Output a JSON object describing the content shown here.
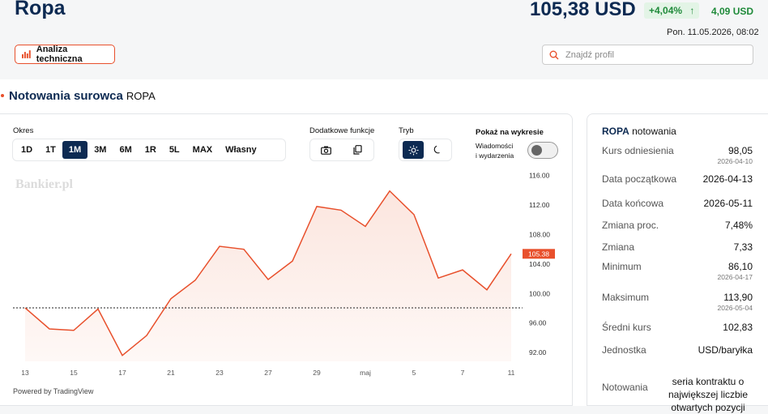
{
  "header": {
    "title": "Ropa",
    "price": "105,38 USD",
    "change_pct": "+4,04%",
    "change_arrow": "↑",
    "change_abs": "4,09 USD",
    "datetime": "Pon. 11.05.2026, 08:02",
    "tech_button": "Analiza techniczna",
    "search_placeholder": "Znajdź profil"
  },
  "section": {
    "title": "Notowania surowca",
    "subtitle": "ROPA"
  },
  "controls": {
    "period_label": "Okres",
    "periods": [
      "1D",
      "1T",
      "1M",
      "3M",
      "6M",
      "1R",
      "5L",
      "MAX",
      "Własny"
    ],
    "active_period": "1M",
    "additional_label": "Dodatkowe funkcje",
    "mode_label": "Tryb",
    "show_label": "Pokaż na wykresie",
    "news_label_1": "Wiadomości",
    "news_label_2": "i wydarzenia"
  },
  "chart_data": {
    "type": "area",
    "x_labels": [
      "13",
      "15",
      "17",
      "21",
      "23",
      "27",
      "29",
      "maj",
      "5",
      "7",
      "11"
    ],
    "x_label_index": [
      0,
      2,
      4,
      6,
      8,
      10,
      12,
      14,
      16,
      18,
      20
    ],
    "values": [
      98.05,
      95.2,
      95.0,
      97.9,
      91.6,
      94.3,
      99.3,
      101.8,
      106.4,
      106.0,
      101.9,
      104.4,
      111.8,
      111.3,
      109.1,
      113.9,
      110.7,
      102.1,
      103.2,
      100.5,
      105.38
    ],
    "y_ticks": [
      "116.00",
      "112.00",
      "108.00",
      "104.00",
      "100.00",
      "96.00",
      "92.00"
    ],
    "ylim": [
      90.8,
      117.5
    ],
    "reference_value": 98.05,
    "last_label": "105.38",
    "watermark": "Bankier.pl",
    "powered_by": "Powered by TradingView",
    "colors": {
      "line": "#e8502c",
      "fill": "#fbe3db",
      "label_bg": "#e8502c"
    }
  },
  "side": {
    "symbol": "ROPA",
    "heading": "notowania",
    "rows": [
      {
        "label": "Kurs odniesienia",
        "value": "98,05",
        "date": "2026-04-10"
      },
      {
        "label": "Data początkowa",
        "value": "2026-04-13"
      },
      {
        "label": "Data końcowa",
        "value": "2026-05-11"
      },
      {
        "label": "Zmiana proc.",
        "value": "7,48%"
      },
      {
        "label": "Zmiana",
        "value": "7,33"
      },
      {
        "label": "Minimum",
        "value": "86,10",
        "date": "2026-04-17"
      },
      {
        "label": "Maksimum",
        "value": "113,90",
        "date": "2026-05-04"
      },
      {
        "label": "Średni kurs",
        "value": "102,83"
      },
      {
        "label": "Jednostka",
        "value": "USD/baryłka"
      }
    ],
    "notowania_label": "Notowania",
    "notowania_value": "seria kontraktu o największej liczbie otwartych pozycji"
  }
}
